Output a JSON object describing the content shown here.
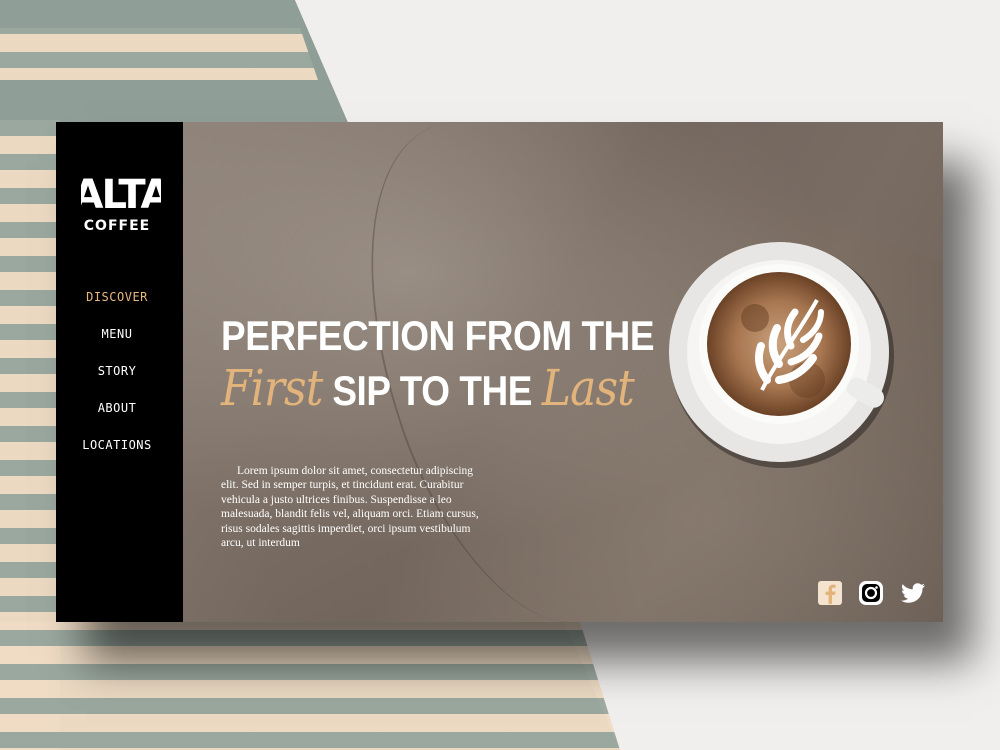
{
  "brand": {
    "logo_text": "ALTA",
    "sub_text": "COFFEE"
  },
  "nav": {
    "items": [
      {
        "label": "DISCOVER",
        "active": true
      },
      {
        "label": "MENU",
        "active": false
      },
      {
        "label": "STORY",
        "active": false
      },
      {
        "label": "ABOUT",
        "active": false
      },
      {
        "label": "LOCATIONS",
        "active": false
      }
    ]
  },
  "hero": {
    "line1": "PERFECTION FROM THE",
    "script1": "First",
    "line2_middle": " SIP TO THE ",
    "script2": "Last",
    "body": "Lorem ipsum dolor sit amet, consectetur adipiscing elit. Sed in semper turpis, et tincidunt erat. Curabitur vehicula a justo ultrices finibus. Suspendisse a leo malesuada, blandit felis vel, aliquam orci. Etiam cursus, risus sodales sagittis imperdiet, orci ipsum vestibulum arcu, ut interdum"
  },
  "social": [
    {
      "icon": "facebook-icon"
    },
    {
      "icon": "instagram-icon"
    },
    {
      "icon": "twitter-icon"
    }
  ],
  "colors": {
    "accent": "#e2b47c",
    "sidebar": "#000000",
    "sage": "#8f9f97"
  }
}
